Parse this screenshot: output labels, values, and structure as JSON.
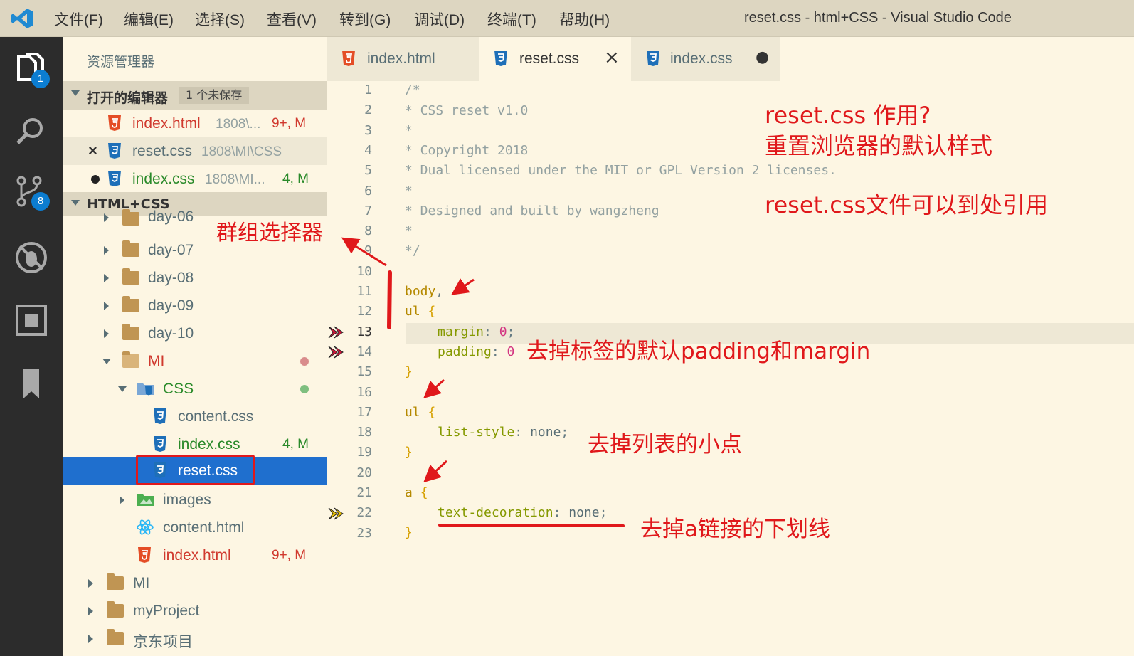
{
  "window": {
    "title": "reset.css - html+CSS - Visual Studio Code"
  },
  "menu": [
    "文件(F)",
    "编辑(E)",
    "选择(S)",
    "查看(V)",
    "转到(G)",
    "调试(D)",
    "终端(T)",
    "帮助(H)"
  ],
  "activity_bar": {
    "explorer_badge": "1",
    "scm_badge": "8"
  },
  "sidebar": {
    "title": "资源管理器",
    "open_editors": {
      "label": "打开的编辑器",
      "unsaved": "1 个未保存",
      "items": [
        {
          "name": "index.html",
          "path": "1808\\...",
          "status": "9+, M"
        },
        {
          "name": "reset.css",
          "path": "1808\\MI\\CSS",
          "status": ""
        },
        {
          "name": "index.css",
          "path": "1808\\MI...",
          "status": "4, M"
        }
      ]
    },
    "workspace": {
      "label": "HTML+CSS",
      "tree": [
        {
          "name": "day-06"
        },
        {
          "name": "day-07"
        },
        {
          "name": "day-08"
        },
        {
          "name": "day-09"
        },
        {
          "name": "day-10"
        },
        {
          "name": "MI"
        },
        {
          "name": "CSS"
        },
        {
          "name": "content.css"
        },
        {
          "name": "index.css",
          "status": "4, M"
        },
        {
          "name": "reset.css"
        },
        {
          "name": "images"
        },
        {
          "name": "content.html"
        },
        {
          "name": "index.html",
          "status": "9+, M"
        },
        {
          "name": "MI"
        },
        {
          "name": "myProject"
        },
        {
          "name": "京东项目"
        }
      ]
    }
  },
  "tabs": [
    {
      "label": "index.html"
    },
    {
      "label": "reset.css",
      "close": "×"
    },
    {
      "label": "index.css",
      "dirty": "●"
    }
  ],
  "editor": {
    "line_numbers": [
      "1",
      "2",
      "3",
      "4",
      "5",
      "6",
      "7",
      "8",
      "9",
      "10",
      "11",
      "12",
      "13",
      "14",
      "15",
      "16",
      "17",
      "18",
      "19",
      "20",
      "21",
      "22",
      "23"
    ],
    "comment_lines": [
      "/*",
      "* CSS reset v1.0",
      "*",
      "* Copyright 2018",
      "* Dual licensed under the MIT or GPL Version 2 licenses.",
      "*",
      "* Designed and built by wangzheng",
      "*",
      "*/"
    ],
    "code": {
      "body": "body",
      "comma": ",",
      "ul": "ul",
      "open_brace": "{",
      "close_brace": "}",
      "margin": "margin",
      "padding": "padding",
      "colon": ":",
      "zero": "0",
      "semicolon": ";",
      "list_style": "list-style",
      "none": "none",
      "a": "a",
      "text_decoration": "text-decoration"
    }
  },
  "annotations": {
    "title_line1": "reset.css 作用?",
    "title_line2": "重置浏览器的默认样式",
    "import_note": "reset.css文件可以到处引用",
    "group_selector": "群组选择器",
    "margin_padding": "去掉标签的默认padding和margin",
    "list_dot": "去掉列表的小点",
    "underline": "去掉a链接的下划线"
  },
  "colors": {
    "annotation": "#e0181b",
    "selection": "#1f6fce",
    "explorer_badge": "#0c7dd1"
  }
}
